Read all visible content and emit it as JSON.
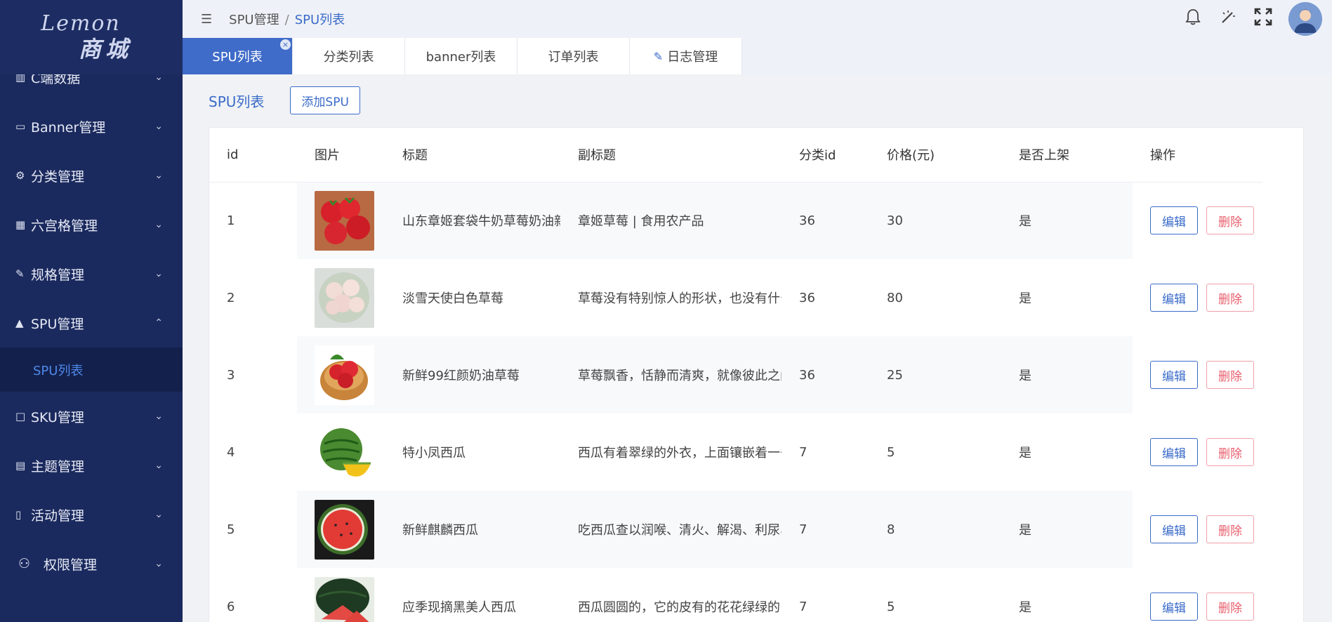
{
  "logo": {
    "line1": "Lemon",
    "line2": "商城"
  },
  "sidebar": {
    "items": [
      {
        "icon": "bar-chart-icon",
        "glyph": "▥",
        "label": "C端数据"
      },
      {
        "icon": "banner-icon",
        "glyph": "▭",
        "label": "Banner管理"
      },
      {
        "icon": "category-icon",
        "glyph": "⚙",
        "label": "分类管理"
      },
      {
        "icon": "grid-icon",
        "glyph": "▦",
        "label": "六宫格管理"
      },
      {
        "icon": "tag-icon",
        "glyph": "✎",
        "label": "规格管理"
      },
      {
        "icon": "bag-icon",
        "glyph": "▲",
        "label": "SPU管理",
        "expanded": true
      },
      {
        "icon": "bag-outline-icon",
        "glyph": "□",
        "label": "SKU管理"
      },
      {
        "icon": "theme-icon",
        "glyph": "▤",
        "label": "主题管理"
      },
      {
        "icon": "activity-icon",
        "glyph": "▯",
        "label": "活动管理"
      },
      {
        "icon": "user-lock-icon",
        "glyph": "⚇",
        "label": "权限管理"
      }
    ],
    "submenu_label": "SPU列表"
  },
  "header": {
    "breadcrumb": {
      "parent": "SPU管理",
      "current": "SPU列表"
    }
  },
  "tabs": [
    {
      "label": "SPU列表",
      "active": true
    },
    {
      "label": "分类列表"
    },
    {
      "label": "banner列表"
    },
    {
      "label": "订单列表"
    },
    {
      "label": "日志管理",
      "icon": "edit-icon"
    }
  ],
  "main": {
    "title": "SPU列表",
    "add_label": "添加SPU",
    "columns": [
      "id",
      "图片",
      "标题",
      "副标题",
      "分类id",
      "价格(元)",
      "是否上架",
      "操作"
    ],
    "edit_label": "编辑",
    "delete_label": "删除",
    "rows": [
      {
        "id": "1",
        "title": "山东章姬套袋牛奶草莓奶油新",
        "subtitle": "章姬草莓 | 食用农产品",
        "category_id": "36",
        "price": "30",
        "online": "是",
        "img": "strawberry"
      },
      {
        "id": "2",
        "title": "淡雪天使白色草莓",
        "subtitle": "草莓没有特别惊人的形状，也没有什么",
        "category_id": "36",
        "price": "80",
        "online": "是",
        "img": "white-strawberry"
      },
      {
        "id": "3",
        "title": "新鲜99红颜奶油草莓",
        "subtitle": "草莓飘香，恬静而清爽，就像彼此之间",
        "category_id": "36",
        "price": "25",
        "online": "是",
        "img": "strawberry-basket"
      },
      {
        "id": "4",
        "title": "特小凤西瓜",
        "subtitle": "西瓜有着翠绿的外衣，上面镶嵌着一条",
        "category_id": "7",
        "price": "5",
        "online": "是",
        "img": "melon"
      },
      {
        "id": "5",
        "title": "新鲜麒麟西瓜",
        "subtitle": "吃西瓜查以润喉、清火、解渴、利尿、",
        "category_id": "7",
        "price": "8",
        "online": "是",
        "img": "watermelon-half"
      },
      {
        "id": "6",
        "title": "应季现摘黑美人西瓜",
        "subtitle": "西瓜圆圆的，它的皮有的花花绿绿的，",
        "category_id": "7",
        "price": "5",
        "online": "是",
        "img": "watermelon-dark"
      }
    ]
  }
}
